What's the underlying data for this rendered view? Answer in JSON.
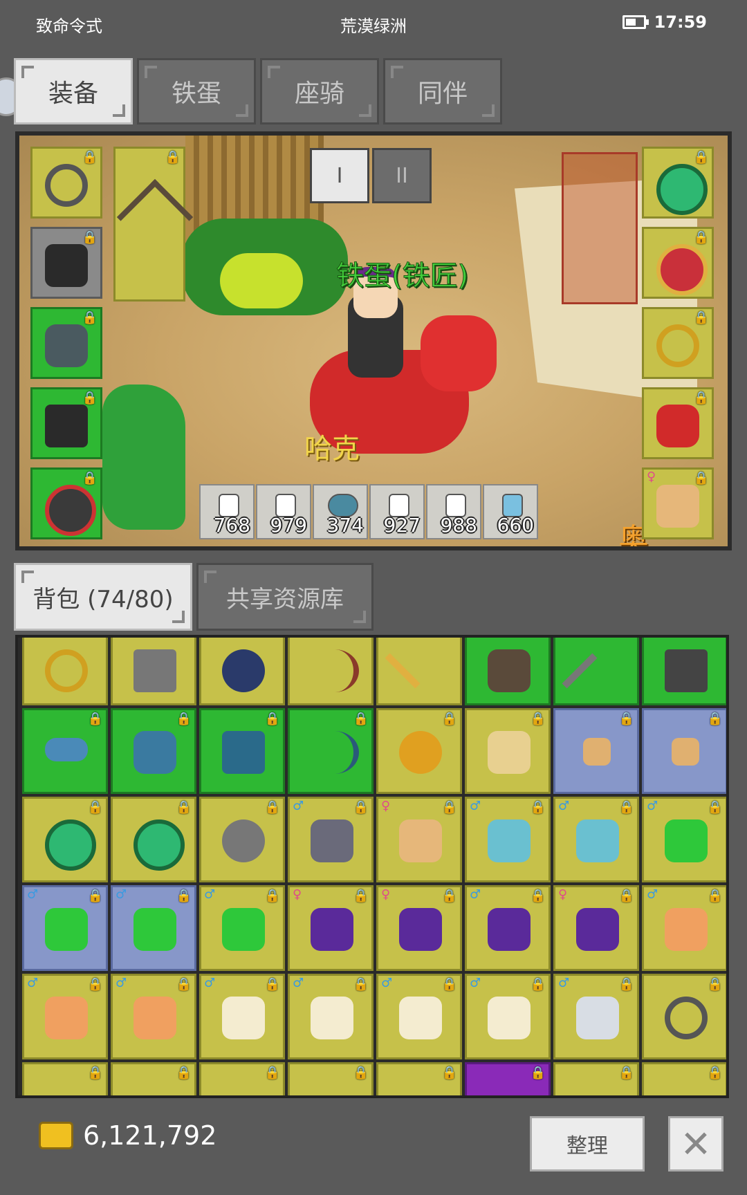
{
  "status_bar": {
    "left_title": "致命令式",
    "center_title": "荒漠绿洲",
    "time": "17:59"
  },
  "top_tabs": [
    {
      "label": "装备",
      "active": true
    },
    {
      "label": "铁蛋",
      "active": false
    },
    {
      "label": "座骑",
      "active": false
    },
    {
      "label": "同伴",
      "active": false
    }
  ],
  "scene": {
    "character_label": "铁蛋(铁匠)",
    "pet_label": "哈克",
    "corner_text": "奥",
    "page_buttons": [
      "I",
      "II"
    ],
    "potions": [
      "768",
      "979",
      "374",
      "927",
      "988",
      "660"
    ]
  },
  "bag_tabs": [
    {
      "label": "背包 (74/80)",
      "active": true
    },
    {
      "label": "共享资源库",
      "active": false
    }
  ],
  "footer": {
    "gold": "6,121,792",
    "sort_label": "整理",
    "close_icon": "✕"
  },
  "icons": {
    "lock": "🔒",
    "male": "♂",
    "female": "♀"
  },
  "colors": {
    "yellow": "#c6c14a",
    "green": "#2eb833",
    "blue": "#8797c9",
    "purple": "#8a2ab8"
  }
}
